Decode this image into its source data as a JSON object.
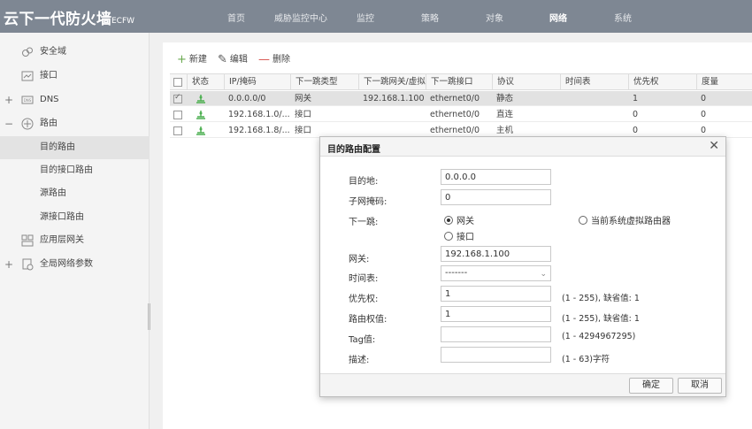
{
  "header": {
    "brand": "云下一代防火墙",
    "brand_sub": "ECFW",
    "nav": [
      "首页",
      "威胁监控中心",
      "监控",
      "策略",
      "对象",
      "网络",
      "系统"
    ],
    "active_nav": "网络"
  },
  "sidebar": {
    "items": [
      {
        "label": "安全域"
      },
      {
        "label": "接口"
      },
      {
        "label": "DNS",
        "toggle": "+"
      },
      {
        "label": "路由",
        "toggle": "−"
      },
      {
        "label": "目的路由"
      },
      {
        "label": "目的接口路由"
      },
      {
        "label": "源路由"
      },
      {
        "label": "源接口路由"
      },
      {
        "label": "应用层网关"
      },
      {
        "label": "全局网络参数",
        "toggle": "+"
      }
    ]
  },
  "toolbar": {
    "new_label": "新建",
    "edit_label": "编辑",
    "delete_label": "删除"
  },
  "table": {
    "columns": [
      "状态",
      "IP/掩码",
      "下一跳类型",
      "下一跳网关/虚拟...",
      "下一跳接口",
      "协议",
      "时间表",
      "优先权",
      "度量"
    ],
    "rows": [
      {
        "ip": "0.0.0.0/0",
        "type": "网关",
        "gateway": "192.168.1.100",
        "iface": "ethernet0/0",
        "proto": "静态",
        "schedule": "",
        "priority": "1",
        "metric": "0"
      },
      {
        "ip": "192.168.1.0/...",
        "type": "接口",
        "gateway": "",
        "iface": "ethernet0/0",
        "proto": "直连",
        "schedule": "",
        "priority": "0",
        "metric": "0"
      },
      {
        "ip": "192.168.1.8/...",
        "type": "接口",
        "gateway": "",
        "iface": "ethernet0/0",
        "proto": "主机",
        "schedule": "",
        "priority": "0",
        "metric": "0"
      }
    ]
  },
  "dialog": {
    "title": "目的路由配置",
    "dest_label": "目的地:",
    "dest_value": "0.0.0.0",
    "mask_label": "子网掩码:",
    "mask_value": "0",
    "nexthop_label": "下一跳:",
    "radio_gateway": "网关",
    "radio_iface": "接口",
    "radio_vrouter": "当前系统虚拟路由器",
    "gateway_label": "网关:",
    "gateway_value": "192.168.1.100",
    "schedule_label": "时间表:",
    "schedule_value": "-------",
    "priority_label": "优先权:",
    "priority_value": "1",
    "priority_hint": "(1 - 255),   缺省值:   1",
    "weight_label": "路由权值:",
    "weight_value": "1",
    "weight_hint": "(1 - 255),   缺省值:   1",
    "tag_label": "Tag值:",
    "tag_value": "",
    "tag_hint": "(1 - 4294967295)",
    "desc_label": "描述:",
    "desc_value": "",
    "desc_hint": "(1 - 63)字符",
    "ok_label": "确定",
    "cancel_label": "取消"
  }
}
